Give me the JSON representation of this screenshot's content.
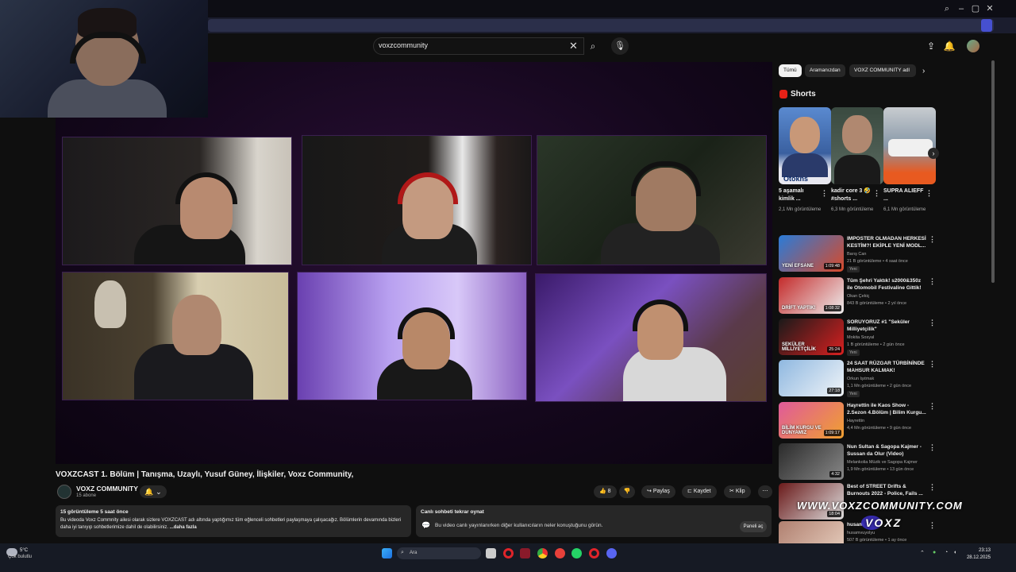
{
  "search": {
    "query": "voxzcommunity"
  },
  "video": {
    "title": "VOXZCAST 1. Bölüm | Tanışma, Uzaylı, Yusuf Güney, İlişkiler, Voxz Community,",
    "channel": "VOXZ COMMUNITY",
    "subscribers": "15 abone",
    "likes": "8",
    "share_label": "Paylaş",
    "save_label": "Kaydet",
    "clip_label": "Klip"
  },
  "description": {
    "meta": "15 görüntüleme  5 saat önce",
    "text": "Bu videoda Voxz Commnity ailesi olarak sizlere VOXZCAST adı altında yaptığımız tüm eğlenceli sohbetleri paylaşmaya çalışacağız. Bölümlerin devamında bizleri daha iyi tanıyıp sohbetlerimize dahil de olabilirsiniz.",
    "more": "...daha fazla"
  },
  "chat": {
    "title": "Canlı sohbeti tekrar oynat",
    "text": "Bu video canlı yayınlanırken diğer kullanıcıların neler konuştuğunu görün.",
    "panel_button": "Paneli aç"
  },
  "chips": [
    "Tümü",
    "Aramanızdan",
    "VOXZ COMMUNITY adl"
  ],
  "shorts": {
    "label": "Shorts",
    "items": [
      {
        "title": "5 aşamalı kimlik ...",
        "views": "2,1 Mn görüntüleme",
        "thumb_text": "Otokns"
      },
      {
        "title": "kadir core 3 🤣#shorts ...",
        "views": "6,3 Mn görüntüleme",
        "thumb_text": ""
      },
      {
        "title": "SUPRA ALIEFF ...",
        "views": "6,1 Mn görüntüleme",
        "thumb_text": ""
      }
    ]
  },
  "recommendations": [
    {
      "title": "IMPOSTER OLMADAN HERKESİ KESTİM?! EKİPLE YENİ MODL...",
      "channel": "Barış Can",
      "meta": "21 B görüntüleme • 4 saat önce",
      "badge": "Yeni",
      "duration": "1:09:48",
      "thumb_text": "YENİ EFSANE",
      "colors": [
        "#2a7bd8",
        "#d84a2a"
      ]
    },
    {
      "title": "Tüm Şehri Yaktık! s2000&350z ile Otomobil Festivaline Gittik!",
      "channel": "Okan Çekiç",
      "meta": "843 B görüntüleme • 2 yıl önce",
      "badge": "",
      "duration": "1:08:32",
      "thumb_text": "DRİFT YAPTIK!",
      "colors": [
        "#c42b2b",
        "#eee"
      ]
    },
    {
      "title": "SORUYORUZ #1 \"Seküler Milliyetçilik\"",
      "channel": "Mokita Sosyal",
      "meta": "1 B görüntüleme • 2 gün önce",
      "badge": "Yeni",
      "duration": "25:24",
      "thumb_text": "SEKÜLER MİLLİYETÇİLİK",
      "colors": [
        "#1a1a1a",
        "#d82020"
      ]
    },
    {
      "title": "24 SAAT RÜZGAR TÜRBİNİNDE MAHSUR KALMAK!",
      "channel": "Orkun Işıtmak",
      "meta": "1,1 Mn görüntüleme • 2 gün önce",
      "badge": "Yeni",
      "duration": "27:18",
      "thumb_text": "",
      "colors": [
        "#8fb8e0",
        "#f0f4f8"
      ]
    },
    {
      "title": "Hayrettin ile Kaos Show - 2.Sezon 4.Bölüm | Bilim Kurgu...",
      "channel": "Hayrettin",
      "meta": "4,4 Mn görüntüleme • 9 gün önce",
      "badge": "",
      "duration": "1:09:17",
      "thumb_text": "BİLİM KURGU VE DÜNYAMIZ",
      "colors": [
        "#e05a9a",
        "#f0a030"
      ]
    },
    {
      "title": "Nun Sultan & Sagopa Kajmer - Sussan da Olur (Video)",
      "channel": "Melankolia Müzik ve Sagopa Kajmer",
      "meta": "1,9 Mn görüntüleme • 13 gün önce",
      "badge": "",
      "duration": "4:32",
      "thumb_text": "",
      "colors": [
        "#2a2a2a",
        "#888"
      ]
    },
    {
      "title": "Best of STREET Drifts & Burnouts 2022 - Police, Fails ...",
      "channel": "",
      "meta": "",
      "badge": "",
      "duration": "18:04",
      "thumb_text": "",
      "colors": [
        "#6a1a1a",
        "#ddd"
      ]
    },
    {
      "title": "husam",
      "channel": "husamvuyolyu",
      "meta": "507 B görüntüleme • 1 ay önce",
      "badge": "",
      "duration": "",
      "thumb_text": "",
      "colors": [
        "#b08070",
        "#e8d0c0"
      ]
    }
  ],
  "watermark": {
    "site": "WWW.VOXZCOMMUNITY.COM",
    "brand": "VOXZ"
  },
  "taskbar": {
    "temp": "5°C",
    "weather": "Çok bulutlu",
    "search_placeholder": "Ara",
    "time": "23:13",
    "date": "28.12.2025"
  },
  "colors": {
    "accent": "#ff0000",
    "player_bg": "#1a0a24"
  }
}
